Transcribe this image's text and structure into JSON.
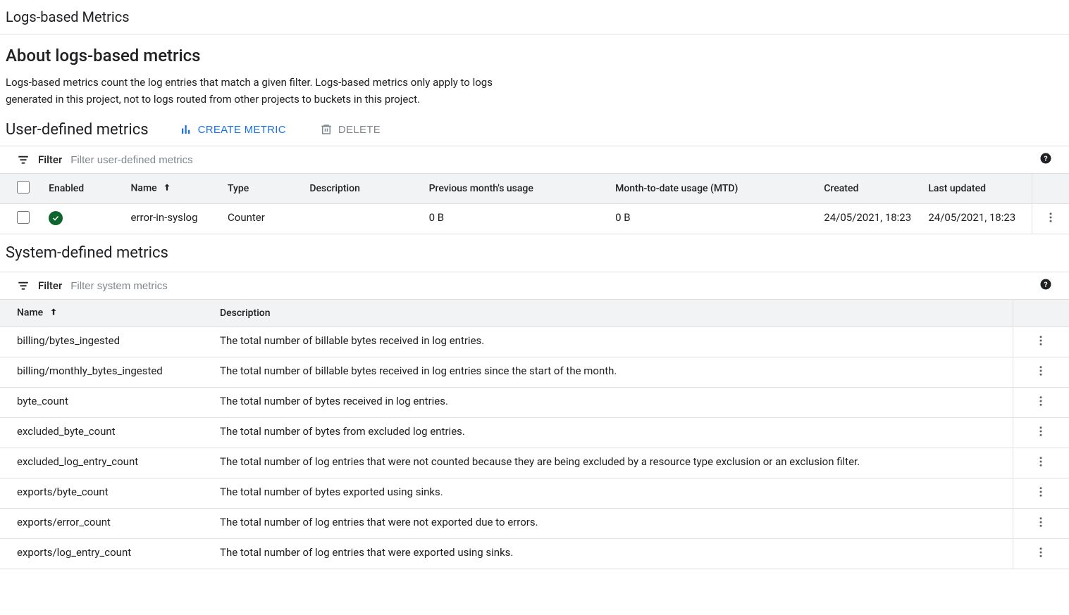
{
  "header": {
    "page_title": "Logs-based Metrics"
  },
  "about": {
    "heading": "About logs-based metrics",
    "description": "Logs-based metrics count the log entries that match a given filter. Logs-based metrics only apply to logs generated in this project, not to logs routed from other projects to buckets in this project."
  },
  "user_metrics": {
    "heading": "User-defined metrics",
    "actions": {
      "create": "CREATE METRIC",
      "delete": "DELETE"
    },
    "filter": {
      "label": "Filter",
      "placeholder": "Filter user-defined metrics"
    },
    "columns": {
      "enabled": "Enabled",
      "name": "Name",
      "type": "Type",
      "description": "Description",
      "prev_usage": "Previous month's usage",
      "mtd_usage": "Month-to-date usage (MTD)",
      "created": "Created",
      "updated": "Last updated"
    },
    "rows": [
      {
        "enabled": true,
        "name": "error-in-syslog",
        "type": "Counter",
        "description": "",
        "prev_usage": "0 B",
        "mtd_usage": "0 B",
        "created": "24/05/2021, 18:23",
        "updated": "24/05/2021, 18:23"
      }
    ]
  },
  "system_metrics": {
    "heading": "System-defined metrics",
    "filter": {
      "label": "Filter",
      "placeholder": "Filter system metrics"
    },
    "columns": {
      "name": "Name",
      "description": "Description"
    },
    "rows": [
      {
        "name": "billing/bytes_ingested",
        "description": "The total number of billable bytes received in log entries."
      },
      {
        "name": "billing/monthly_bytes_ingested",
        "description": "The total number of billable bytes received in log entries since the start of the month."
      },
      {
        "name": "byte_count",
        "description": "The total number of bytes received in log entries."
      },
      {
        "name": "excluded_byte_count",
        "description": "The total number of bytes from excluded log entries."
      },
      {
        "name": "excluded_log_entry_count",
        "description": "The total number of log entries that were not counted because they are being excluded by a resource type exclusion or an exclusion filter."
      },
      {
        "name": "exports/byte_count",
        "description": "The total number of bytes exported using sinks."
      },
      {
        "name": "exports/error_count",
        "description": "The total number of log entries that were not exported due to errors."
      },
      {
        "name": "exports/log_entry_count",
        "description": "The total number of log entries that were exported using sinks."
      }
    ]
  }
}
